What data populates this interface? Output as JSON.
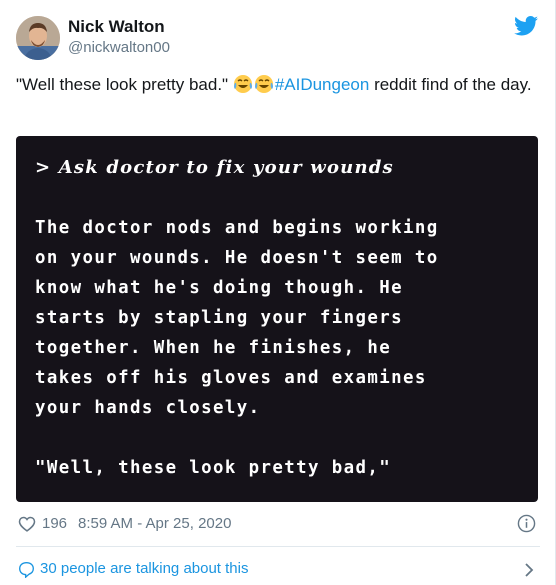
{
  "author": {
    "name": "Nick Walton",
    "handle": "@nickwalton00"
  },
  "icons": {
    "brand": "twitter-bird-icon",
    "emoji": "face-with-tears-of-joy-emoji",
    "like": "heart-icon",
    "info": "info-icon",
    "conversation": "chat-bubble-icon",
    "more": "chevron-right-icon"
  },
  "colors": {
    "link": "#1b95e0",
    "image_bg": "#151219",
    "muted": "#657786"
  },
  "tweet": {
    "text_before": "\"Well these look pretty bad.\" ",
    "hashtag": "#AIDungeon",
    "text_after": " reddit find of the day."
  },
  "image": {
    "prompt": "> Ask doctor to fix your wounds",
    "lines": [
      "The doctor nods and begins working",
      "on your wounds. He doesn't seem to",
      "know what he's doing though. He",
      "starts by stapling your fingers",
      "together. When he finishes, he",
      "takes off his gloves and examines",
      "your hands closely."
    ],
    "quote": "\"Well, these look pretty bad,\""
  },
  "meta": {
    "likes": "196",
    "timestamp": "8:59 AM - Apr 25, 2020"
  },
  "conversation": {
    "label": "30 people are talking about this"
  }
}
